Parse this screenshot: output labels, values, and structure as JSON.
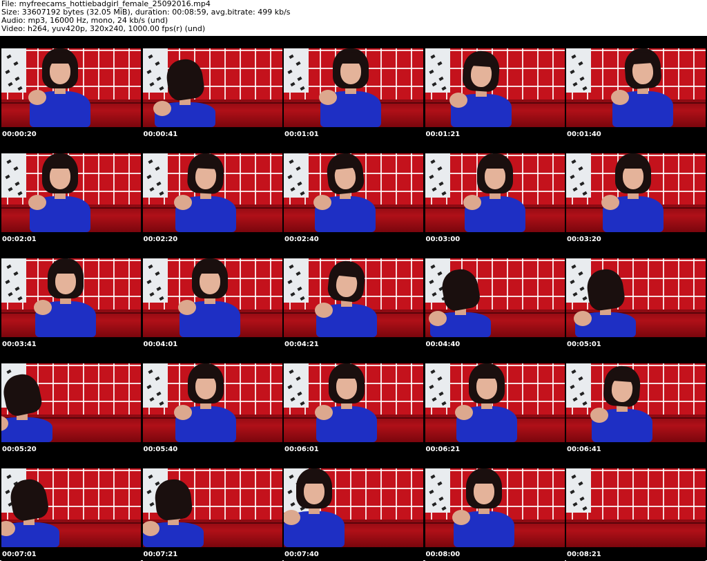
{
  "header": {
    "file_line": "File: myfreecams_hottiebadgirl_female_25092016.mp4",
    "size_line": "Size: 33607192 bytes (32.05 MiB), duration: 00:08:59, avg.bitrate: 499 kb/s",
    "audio_line": "Audio: mp3, 16000 Hz, mono, 24 kb/s (und)",
    "video_line": "Video: h264, yuv420p, 320x240, 1000.00 fps(r) (und)"
  },
  "colors": {
    "sheet_background": "#000000",
    "wall": "#c4121c",
    "top": "#1e2fc4",
    "timestamp": "#ffffff"
  },
  "thumbnails": [
    {
      "time": "00:00:20",
      "pose": "upright",
      "offset": 0.42,
      "tilt": 0
    },
    {
      "time": "00:00:41",
      "pose": "leaning",
      "offset": 0.3,
      "tilt": -8
    },
    {
      "time": "00:01:01",
      "pose": "upright",
      "offset": 0.48,
      "tilt": 0
    },
    {
      "time": "00:01:21",
      "pose": "looking-down",
      "offset": 0.4,
      "tilt": 4
    },
    {
      "time": "00:01:40",
      "pose": "upright",
      "offset": 0.55,
      "tilt": -4
    },
    {
      "time": "00:02:01",
      "pose": "upright",
      "offset": 0.42,
      "tilt": 0
    },
    {
      "time": "00:02:20",
      "pose": "upright",
      "offset": 0.45,
      "tilt": 3
    },
    {
      "time": "00:02:40",
      "pose": "upright",
      "offset": 0.44,
      "tilt": -6
    },
    {
      "time": "00:03:00",
      "pose": "upright",
      "offset": 0.5,
      "tilt": 0
    },
    {
      "time": "00:03:20",
      "pose": "upright",
      "offset": 0.48,
      "tilt": 0
    },
    {
      "time": "00:03:41",
      "pose": "upright",
      "offset": 0.46,
      "tilt": 0
    },
    {
      "time": "00:04:01",
      "pose": "upright",
      "offset": 0.48,
      "tilt": 0
    },
    {
      "time": "00:04:21",
      "pose": "looking-down",
      "offset": 0.45,
      "tilt": 6
    },
    {
      "time": "00:04:40",
      "pose": "leaning",
      "offset": 0.25,
      "tilt": -10
    },
    {
      "time": "00:05:01",
      "pose": "leaning",
      "offset": 0.28,
      "tilt": -8
    },
    {
      "time": "00:05:20",
      "pose": "leaning",
      "offset": 0.15,
      "tilt": -12
    },
    {
      "time": "00:05:40",
      "pose": "upright",
      "offset": 0.45,
      "tilt": 0
    },
    {
      "time": "00:06:01",
      "pose": "upright",
      "offset": 0.45,
      "tilt": 0
    },
    {
      "time": "00:06:21",
      "pose": "upright",
      "offset": 0.44,
      "tilt": 0
    },
    {
      "time": "00:06:41",
      "pose": "looking-down",
      "offset": 0.4,
      "tilt": 4
    },
    {
      "time": "00:07:01",
      "pose": "leaning",
      "offset": 0.2,
      "tilt": -10
    },
    {
      "time": "00:07:21",
      "pose": "leaning",
      "offset": 0.22,
      "tilt": -6
    },
    {
      "time": "00:07:40",
      "pose": "upright",
      "offset": 0.22,
      "tilt": 0
    },
    {
      "time": "00:08:00",
      "pose": "upright",
      "offset": 0.42,
      "tilt": 0
    },
    {
      "time": "00:08:21",
      "pose": "empty",
      "offset": 0.5,
      "tilt": 0
    }
  ]
}
